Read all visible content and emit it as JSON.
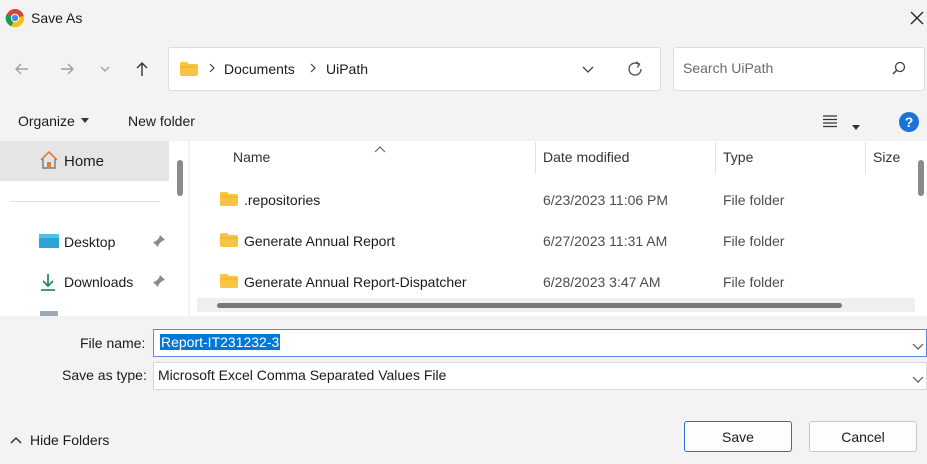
{
  "window": {
    "title": "Save As"
  },
  "breadcrumb": {
    "items": [
      "Documents",
      "UiPath"
    ]
  },
  "search": {
    "placeholder": "Search UiPath"
  },
  "toolbar": {
    "organize_label": "Organize",
    "new_folder_label": "New folder"
  },
  "sidebar": {
    "items": [
      {
        "label": "Home",
        "icon": "home-icon"
      },
      {
        "label": "Desktop",
        "icon": "desktop-icon"
      },
      {
        "label": "Downloads",
        "icon": "download-icon"
      }
    ]
  },
  "file_list": {
    "columns": [
      "Name",
      "Date modified",
      "Type",
      "Size"
    ],
    "rows": [
      {
        "name": ".repositories",
        "date": "6/23/2023 11:06 PM",
        "type": "File folder"
      },
      {
        "name": "Generate Annual Report",
        "date": "6/27/2023 11:31 AM",
        "type": "File folder"
      },
      {
        "name": "Generate Annual Report-Dispatcher",
        "date": "6/28/2023 3:47 AM",
        "type": "File folder"
      }
    ]
  },
  "form": {
    "file_name_label": "File name:",
    "file_name_value": "Report-IT231232-3",
    "save_type_label": "Save as type:",
    "save_type_value": "Microsoft Excel Comma Separated Values File"
  },
  "footer": {
    "hide_folders_label": "Hide Folders",
    "save_label": "Save",
    "cancel_label": "Cancel"
  },
  "colors": {
    "accent": "#0078d7",
    "folder": "#f8c542",
    "help": "#1a73d6"
  }
}
